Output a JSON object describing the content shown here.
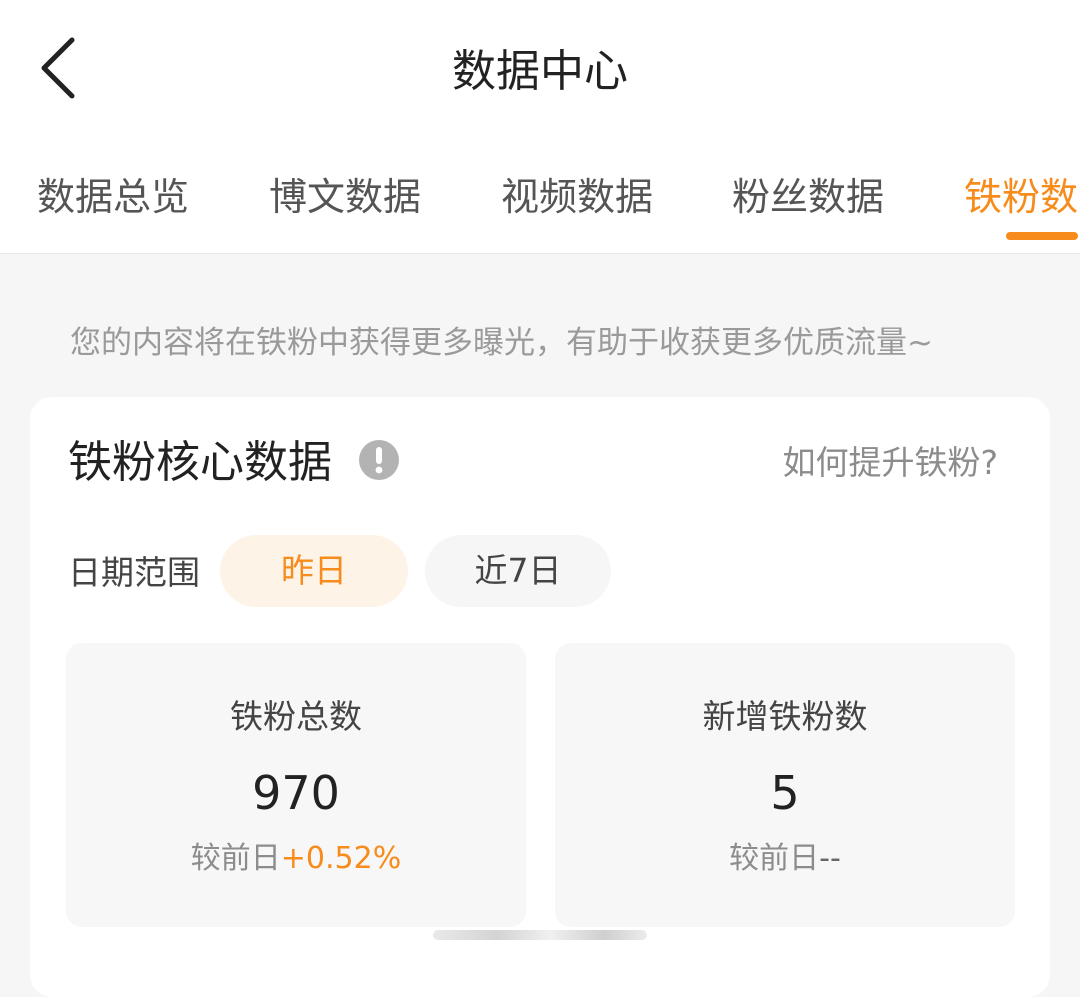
{
  "header": {
    "title": "数据中心",
    "back_icon": "chevron-left-icon"
  },
  "tabs": [
    {
      "label": "数据总览",
      "active": false
    },
    {
      "label": "博文数据",
      "active": false
    },
    {
      "label": "视频数据",
      "active": false
    },
    {
      "label": "粉丝数据",
      "active": false
    },
    {
      "label": "铁粉数",
      "active": true
    }
  ],
  "colors": {
    "accent": "#f78c1c",
    "background": "#f6f6f6",
    "card": "#ffffff",
    "chip_active_bg": "#fef3e7"
  },
  "tip": "您的内容将在铁粉中获得更多曝光，有助于收获更多优质流量~",
  "card": {
    "title": "铁粉核心数据",
    "info_icon": "exclamation-circle-icon",
    "help_link": "如何提升铁粉?",
    "range_label": "日期范围",
    "ranges": [
      {
        "label": "昨日",
        "selected": true
      },
      {
        "label": "近7日",
        "selected": false
      }
    ],
    "stats": [
      {
        "label": "铁粉总数",
        "value": "970",
        "change_prefix": "较前日",
        "change_value": "+0.52%"
      },
      {
        "label": "新增铁粉数",
        "value": "5",
        "change_prefix": "较前日",
        "change_value": "--"
      }
    ]
  }
}
